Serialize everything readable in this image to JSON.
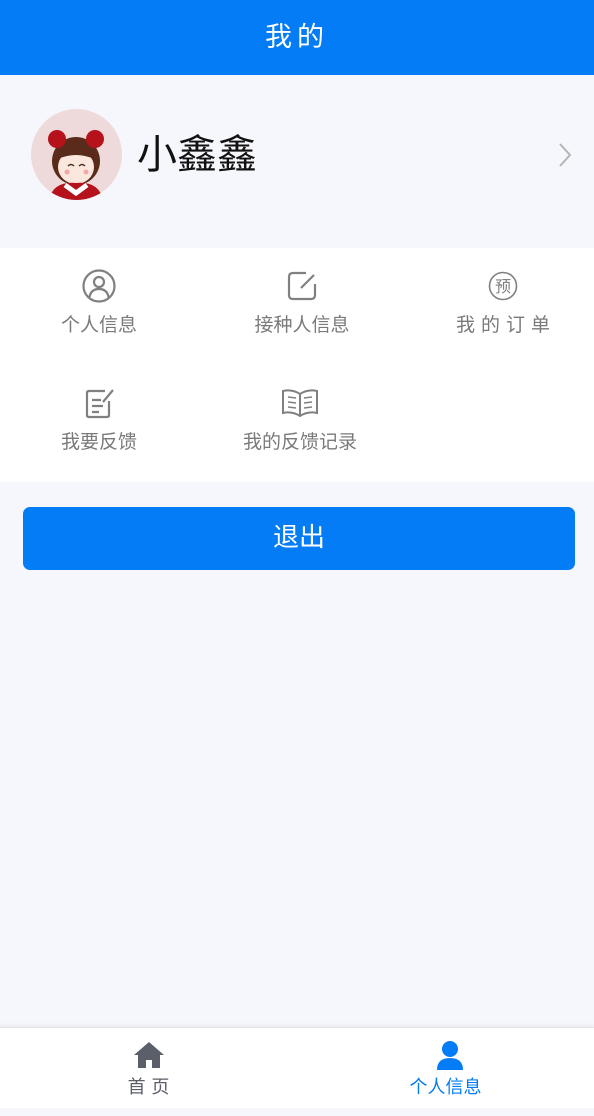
{
  "header": {
    "title": "我的"
  },
  "profile": {
    "name": "小鑫鑫"
  },
  "menu": {
    "items": [
      {
        "label": "个人信息",
        "icon": "user-circle-icon"
      },
      {
        "label": "接种人信息",
        "icon": "edit-square-icon"
      },
      {
        "label": "我 的 订 单",
        "icon": "yu-circle-icon",
        "icon_text": "预"
      },
      {
        "label": "我要反馈",
        "icon": "feedback-edit-icon"
      },
      {
        "label": "我的反馈记录",
        "icon": "open-book-icon"
      }
    ]
  },
  "logout": {
    "label": "退出"
  },
  "tabbar": {
    "tabs": [
      {
        "label": "首 页",
        "icon": "home-icon",
        "active": false
      },
      {
        "label": "个人信息",
        "icon": "person-icon",
        "active": true
      }
    ]
  },
  "colors": {
    "primary": "#037cf5",
    "background": "#f6f7fc",
    "text_gray": "#7a7a7a",
    "icon_gray": "#5a5f69"
  }
}
